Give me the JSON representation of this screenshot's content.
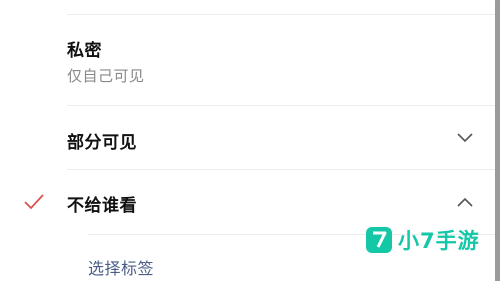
{
  "options": [
    {
      "title": "私密",
      "subtitle": "仅自己可见"
    },
    {
      "title": "部分可见",
      "chevron": "chevron-down-icon"
    },
    {
      "title": "不给谁看",
      "chevron": "chevron-up-icon",
      "selected": true
    }
  ],
  "sublist": {
    "link": "选择标签"
  },
  "watermark": {
    "text": "小7手游",
    "logo_char": "7"
  },
  "colors": {
    "check": "#d9534f",
    "link": "#4a5e86",
    "watermark": "#13c7a7"
  }
}
